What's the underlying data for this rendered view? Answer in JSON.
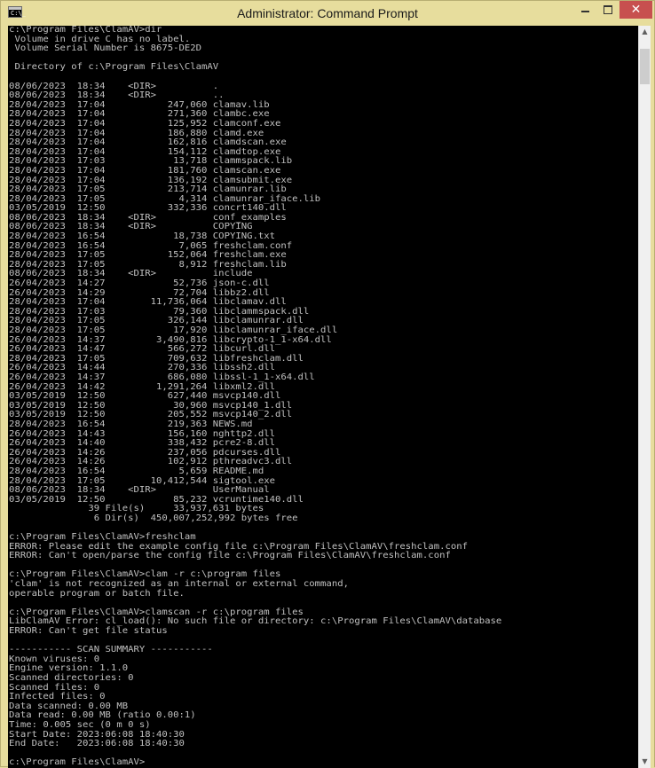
{
  "window": {
    "title": "Administrator: Command Prompt",
    "icon_label": "C:\\_",
    "controls": {
      "close_label": "✕"
    }
  },
  "console": {
    "lines": [
      "c:\\Program Files\\ClamAV>dir",
      " Volume in drive C has no label.",
      " Volume Serial Number is 8675-DE2D",
      "",
      " Directory of c:\\Program Files\\ClamAV",
      "",
      "08/06/2023  18:34    <DIR>          .",
      "08/06/2023  18:34    <DIR>          ..",
      "28/04/2023  17:04           247,060 clamav.lib",
      "28/04/2023  17:04           271,360 clambc.exe",
      "28/04/2023  17:04           125,952 clamconf.exe",
      "28/04/2023  17:04           186,880 clamd.exe",
      "28/04/2023  17:04           162,816 clamdscan.exe",
      "28/04/2023  17:04           154,112 clamdtop.exe",
      "28/04/2023  17:03            13,718 clammspack.lib",
      "28/04/2023  17:04           181,760 clamscan.exe",
      "28/04/2023  17:04           136,192 clamsubmit.exe",
      "28/04/2023  17:05           213,714 clamunrar.lib",
      "28/04/2023  17:05             4,314 clamunrar_iface.lib",
      "03/05/2019  12:50           332,336 concrt140.dll",
      "08/06/2023  18:34    <DIR>          conf_examples",
      "08/06/2023  18:34    <DIR>          COPYING",
      "28/04/2023  16:54            18,738 COPYING.txt",
      "28/04/2023  16:54             7,065 freshclam.conf",
      "28/04/2023  17:05           152,064 freshclam.exe",
      "28/04/2023  17:05             8,912 freshclam.lib",
      "08/06/2023  18:34    <DIR>          include",
      "26/04/2023  14:27            52,736 json-c.dll",
      "26/04/2023  14:29            72,704 libbz2.dll",
      "28/04/2023  17:04        11,736,064 libclamav.dll",
      "28/04/2023  17:03            79,360 libclammspack.dll",
      "28/04/2023  17:05           326,144 libclamunrar.dll",
      "28/04/2023  17:05            17,920 libclamunrar_iface.dll",
      "26/04/2023  14:37         3,490,816 libcrypto-1_1-x64.dll",
      "26/04/2023  14:47           566,272 libcurl.dll",
      "28/04/2023  17:05           709,632 libfreshclam.dll",
      "26/04/2023  14:44           270,336 libssh2.dll",
      "26/04/2023  14:37           686,080 libssl-1_1-x64.dll",
      "26/04/2023  14:42         1,291,264 libxml2.dll",
      "03/05/2019  12:50           627,440 msvcp140.dll",
      "03/05/2019  12:50            30,960 msvcp140_1.dll",
      "03/05/2019  12:50           205,552 msvcp140_2.dll",
      "28/04/2023  16:54           219,363 NEWS.md",
      "26/04/2023  14:43           156,160 nghttp2.dll",
      "26/04/2023  14:40           338,432 pcre2-8.dll",
      "26/04/2023  14:26           237,056 pdcurses.dll",
      "26/04/2023  14:26           102,912 pthreadvc3.dll",
      "28/04/2023  16:54             5,659 README.md",
      "28/04/2023  17:05        10,412,544 sigtool.exe",
      "08/06/2023  18:34    <DIR>          UserManual",
      "03/05/2019  12:50            85,232 vcruntime140.dll",
      "              39 File(s)     33,937,631 bytes",
      "               6 Dir(s)  450,007,252,992 bytes free",
      "",
      "c:\\Program Files\\ClamAV>freshclam",
      "ERROR: Please edit the example config file c:\\Program Files\\ClamAV\\freshclam.conf",
      "ERROR: Can't open/parse the config file c:\\Program Files\\ClamAV\\freshclam.conf",
      "",
      "c:\\Program Files\\ClamAV>clam -r c:\\program files",
      "'clam' is not recognized as an internal or external command,",
      "operable program or batch file.",
      "",
      "c:\\Program Files\\ClamAV>clamscan -r c:\\program files",
      "LibClamAV Error: cl_load(): No such file or directory: c:\\Program Files\\ClamAV\\database",
      "ERROR: Can't get file status",
      "",
      "----------- SCAN SUMMARY -----------",
      "Known viruses: 0",
      "Engine version: 1.1.0",
      "Scanned directories: 0",
      "Scanned files: 0",
      "Infected files: 0",
      "Data scanned: 0.00 MB",
      "Data read: 0.00 MB (ratio 0.00:1)",
      "Time: 0.005 sec (0 m 0 s)",
      "Start Date: 2023:06:08 18:40:30",
      "End Date:   2023:06:08 18:40:30",
      "",
      "c:\\Program Files\\ClamAV>"
    ]
  },
  "colors": {
    "titlebar": "#e7dd9d",
    "close_button": "#c7504f",
    "console_bg": "#000000",
    "console_text": "#c0c0c0"
  }
}
